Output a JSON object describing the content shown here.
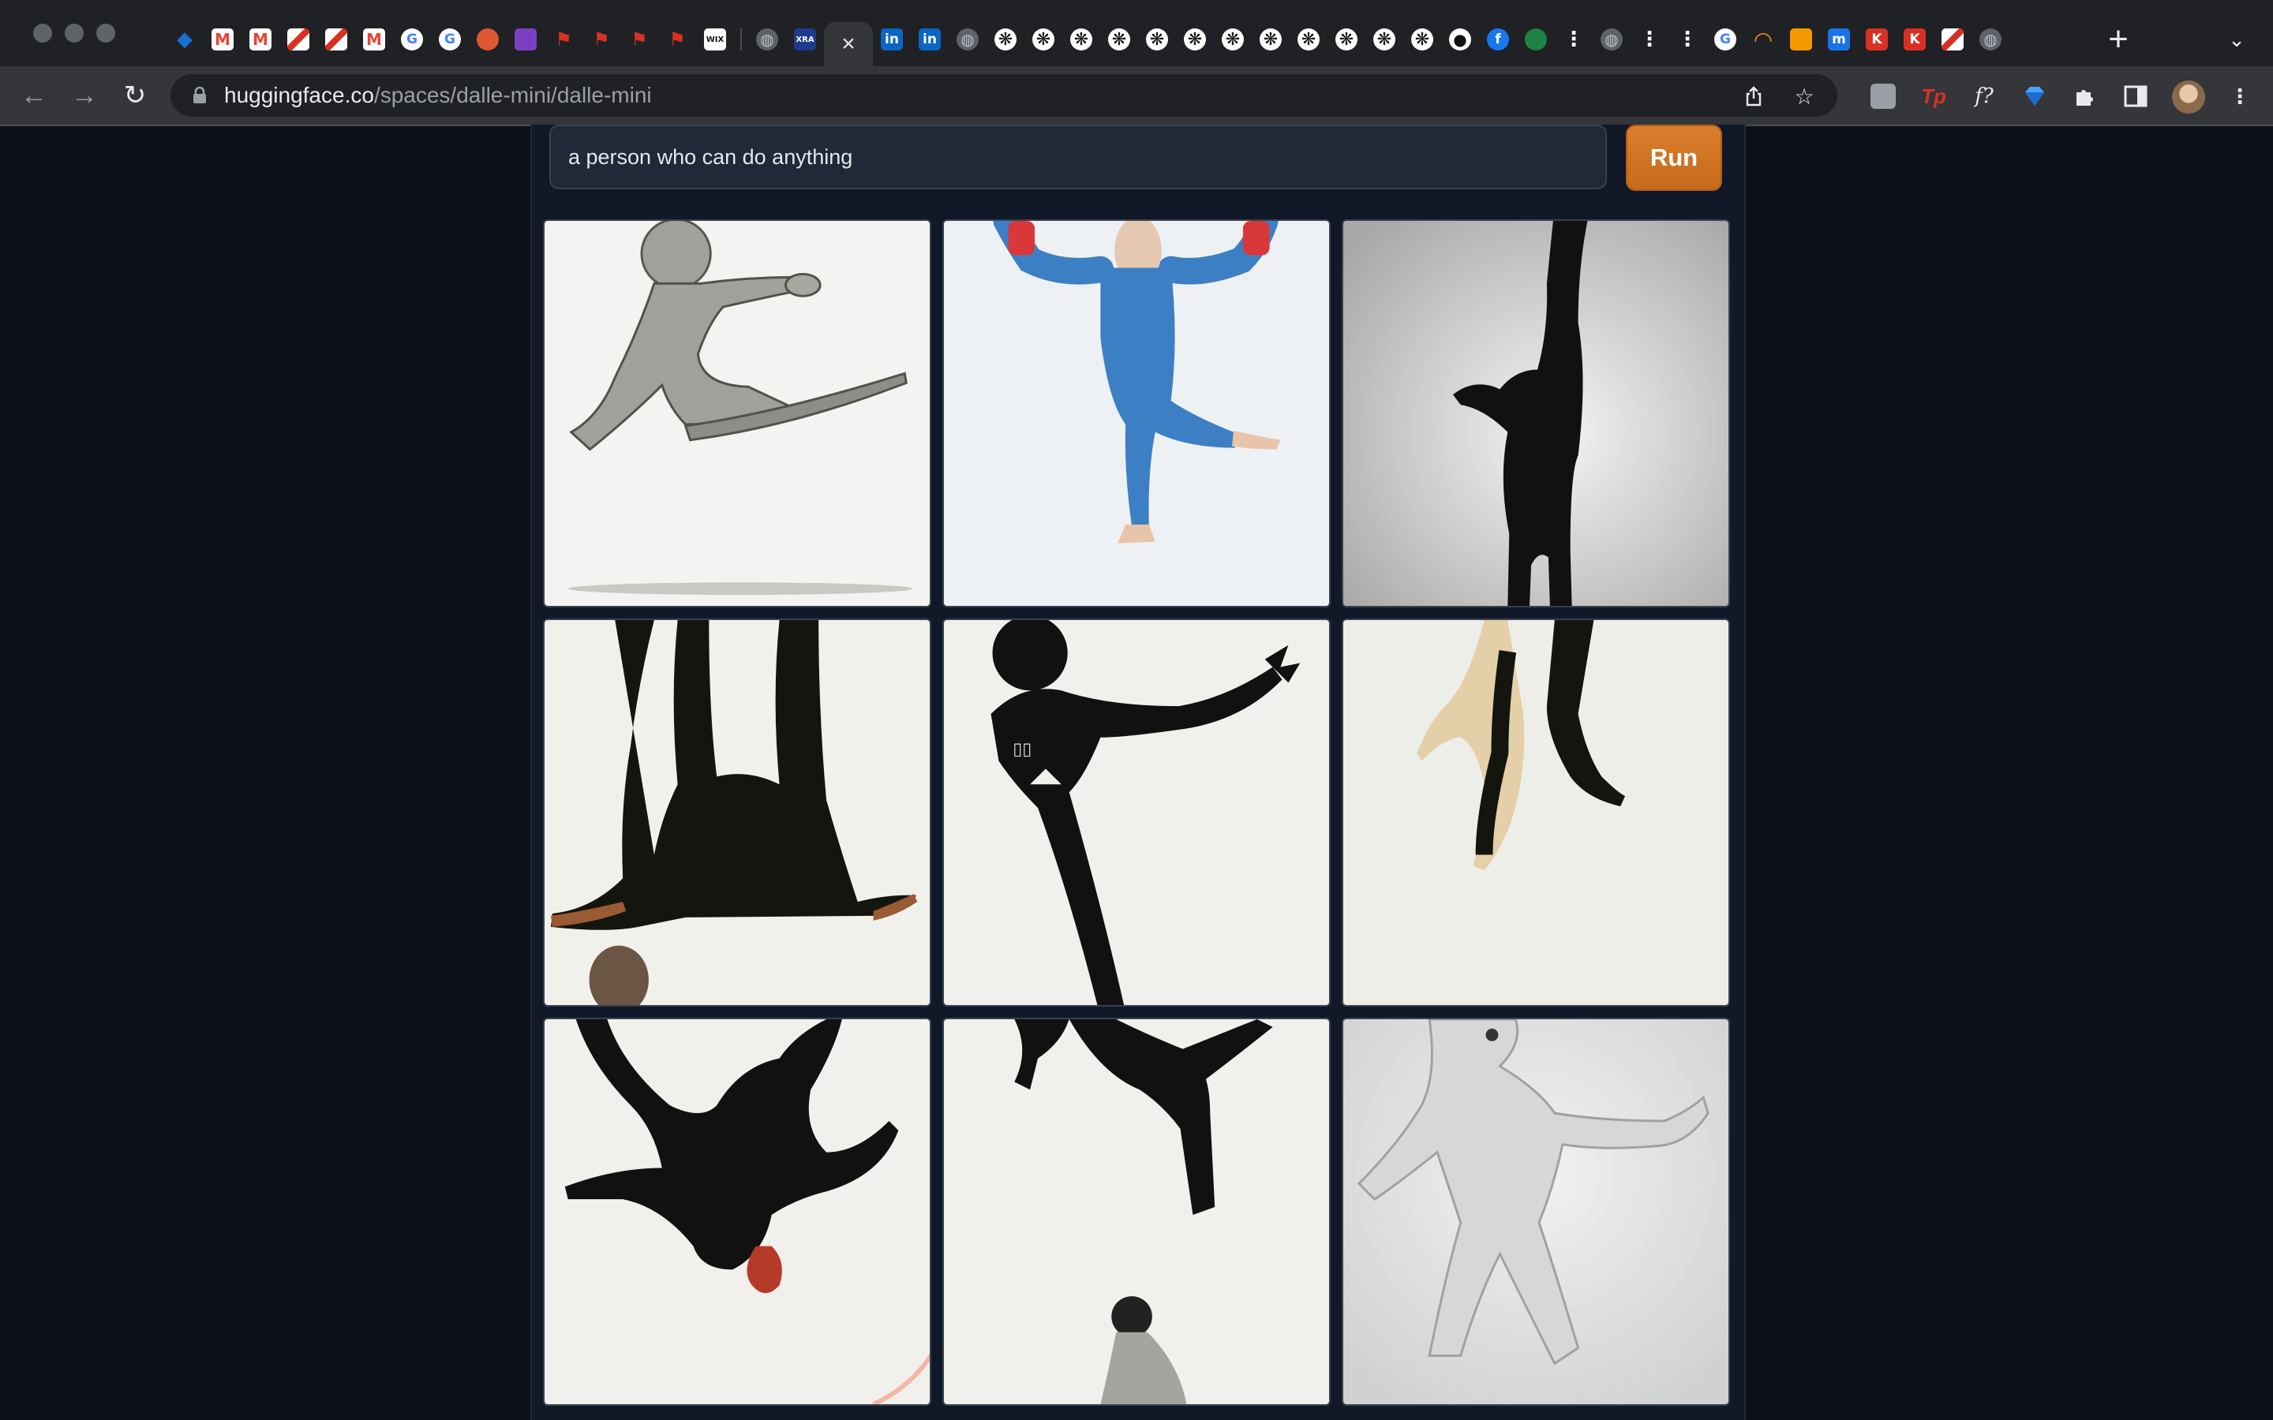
{
  "browser": {
    "tabs": [
      {
        "icon": "sketch-diamond-icon",
        "color": "#1b6fd1"
      },
      {
        "icon": "gmail-icon",
        "color": "#ea4335"
      },
      {
        "icon": "gmail-icon",
        "color": "#ea4335"
      },
      {
        "icon": "red-diagonal-icon",
        "color": "#d93025"
      },
      {
        "icon": "red-diagonal-icon",
        "color": "#d93025"
      },
      {
        "icon": "gmail-icon",
        "color": "#ea4335"
      },
      {
        "icon": "google-icon",
        "color": "#4285f4"
      },
      {
        "icon": "google-icon",
        "color": "#4285f4"
      },
      {
        "icon": "duckduckgo-icon",
        "color": "#de5833"
      },
      {
        "icon": "purple-bolt-icon",
        "color": "#7b3fc4"
      },
      {
        "icon": "red-pin-icon",
        "color": "#d93025"
      },
      {
        "icon": "red-pin-icon",
        "color": "#d93025"
      },
      {
        "icon": "red-pin-icon",
        "color": "#d93025"
      },
      {
        "icon": "red-pin-icon",
        "color": "#d93025"
      },
      {
        "icon": "wix-icon",
        "color": "#ffffff",
        "text": "WIX"
      },
      {
        "icon": "globe-icon",
        "color": "#9aa0a6"
      },
      {
        "icon": "xra-icon",
        "color": "#1e3a8a",
        "text": "XRA"
      },
      {
        "icon": "blank-page-icon",
        "color": "#ffffff"
      },
      {
        "icon": "linkedin-icon",
        "color": "#0a66c2",
        "text": "in"
      },
      {
        "icon": "linkedin-icon",
        "color": "#0a66c2",
        "text": "in"
      },
      {
        "icon": "globe-icon",
        "color": "#9aa0a6"
      },
      {
        "icon": "openai-icon",
        "color": "#ffffff"
      },
      {
        "icon": "openai-icon",
        "color": "#ffffff"
      },
      {
        "icon": "openai-icon",
        "color": "#ffffff"
      },
      {
        "icon": "openai-icon",
        "color": "#ffffff"
      },
      {
        "icon": "openai-icon",
        "color": "#ffffff"
      },
      {
        "icon": "openai-icon",
        "color": "#ffffff"
      },
      {
        "icon": "openai-icon",
        "color": "#ffffff"
      },
      {
        "icon": "openai-icon",
        "color": "#ffffff"
      },
      {
        "icon": "openai-icon",
        "color": "#ffffff"
      },
      {
        "icon": "openai-icon",
        "color": "#ffffff"
      },
      {
        "icon": "openai-icon",
        "color": "#ffffff"
      },
      {
        "icon": "openai-icon",
        "color": "#ffffff"
      },
      {
        "icon": "github-icon",
        "color": "#ffffff"
      },
      {
        "icon": "facebook-icon",
        "color": "#1877f2",
        "text": "f"
      },
      {
        "icon": "green-leaf-icon",
        "color": "#1d8348"
      },
      {
        "icon": "dots-icon",
        "color": "#ffffff"
      },
      {
        "icon": "globe-icon",
        "color": "#9aa0a6"
      },
      {
        "icon": "dots-icon",
        "color": "#ffffff"
      },
      {
        "icon": "dots-icon",
        "color": "#ffffff"
      },
      {
        "icon": "google-icon",
        "color": "#4285f4"
      },
      {
        "icon": "orange-arc-icon",
        "color": "#f28c28"
      },
      {
        "icon": "orange-stack-icon",
        "color": "#f29900"
      },
      {
        "icon": "blue-m-icon",
        "color": "#1a73e8",
        "text": "m"
      },
      {
        "icon": "red-k-icon",
        "color": "#d93025",
        "text": "K"
      },
      {
        "icon": "red-k-icon",
        "color": "#d93025",
        "text": "K"
      },
      {
        "icon": "red-diagonal-icon",
        "color": "#d93025"
      },
      {
        "icon": "globe-icon",
        "color": "#9aa0a6"
      }
    ],
    "active_tab_index": 17,
    "url_host": "huggingface.co",
    "url_path": "/spaces/dalle-mini/dalle-mini"
  },
  "app": {
    "prompt_value": "a person who can do anything",
    "run_label": "Run",
    "accent_color": "#d97f2d",
    "images": [
      {
        "name": "generated-image-1",
        "subject": "grey clay figure kicking"
      },
      {
        "name": "generated-image-2",
        "subject": "figure in blue suit with red gloves"
      },
      {
        "name": "generated-image-3",
        "subject": "black silhouette handstand"
      },
      {
        "name": "generated-image-4",
        "subject": "black silhouette upside down splits"
      },
      {
        "name": "generated-image-5",
        "subject": "black stick figure pointing"
      },
      {
        "name": "generated-image-6",
        "subject": "dancing legs"
      },
      {
        "name": "generated-image-7",
        "subject": "black silhouette spread limbs"
      },
      {
        "name": "generated-image-8",
        "subject": "black silhouette leaping"
      },
      {
        "name": "generated-image-9",
        "subject": "white clay figure"
      }
    ]
  }
}
